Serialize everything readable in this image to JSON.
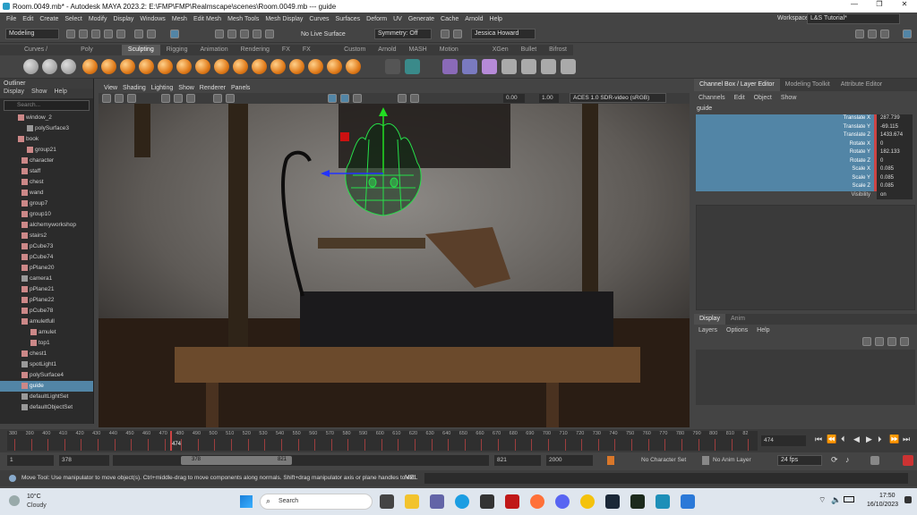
{
  "title": "Room.0049.mb* - Autodesk MAYA 2023.2: E:\\FMP\\FMP\\Realmscape\\scenes\\Room.0049.mb  ---  guide",
  "menu": [
    "File",
    "Edit",
    "Create",
    "Select",
    "Modify",
    "Display",
    "Windows",
    "Mesh",
    "Edit Mesh",
    "Mesh Tools",
    "Mesh Display",
    "Curves",
    "Surfaces",
    "Deform",
    "UV",
    "Generate",
    "Cache",
    "Arnold",
    "Help"
  ],
  "workspace_label": "Workspace:",
  "workspace": "L&S Tutorial*",
  "mode": "Modeling",
  "live_surface": "No Live Surface",
  "symmetry": "Symmetry: Off",
  "user": "Jessica Howard",
  "shelf_tabs": [
    "Curves / Surfaces",
    "Poly Modeling",
    "Sculpting",
    "Rigging",
    "Animation",
    "Rendering",
    "FX",
    "FX Caching",
    "Custom",
    "Arnold",
    "MASH",
    "Motion Graphics",
    "XGen",
    "Bullet",
    "Bifrost"
  ],
  "active_shelf": "Sculpting",
  "outliner": {
    "title": "Outliner",
    "menu": [
      "Display",
      "Show",
      "Help"
    ],
    "search_placeholder": "Search...",
    "items": [
      "window_2",
      "polySurface3",
      "book",
      "group21",
      "character",
      "staff",
      "chest",
      "wand",
      "group7",
      "group10",
      "alchemyworkshop",
      "stairs2",
      "pCube73",
      "pCube74",
      "pPlane20",
      "camera1",
      "pPlane21",
      "pPlane22",
      "pCube78",
      "amuletfull",
      "amulet",
      "top1",
      "chest1",
      "spotLight1",
      "polySurface4",
      "guide",
      "defaultLightSet",
      "defaultObjectSet"
    ],
    "selected": "guide"
  },
  "viewport": {
    "menu": [
      "View",
      "Shading",
      "Lighting",
      "Show",
      "Renderer",
      "Panels"
    ],
    "field_a": "0.00",
    "field_b": "1.00",
    "colorspace": "ACES 1.0 SDR-video (sRGB)"
  },
  "channel_box": {
    "tabs": [
      "Channel Box / Layer Editor",
      "Modeling Toolkit",
      "Attribute Editor"
    ],
    "menu": [
      "Channels",
      "Edit",
      "Object",
      "Show"
    ],
    "object": "guide",
    "attrs": [
      {
        "name": "Translate X",
        "value": "287.739"
      },
      {
        "name": "Translate Y",
        "value": "-69.115"
      },
      {
        "name": "Translate Z",
        "value": "1433.674"
      },
      {
        "name": "Rotate X",
        "value": "0"
      },
      {
        "name": "Rotate Y",
        "value": "182.133"
      },
      {
        "name": "Rotate Z",
        "value": "0"
      },
      {
        "name": "Scale X",
        "value": "0.085"
      },
      {
        "name": "Scale Y",
        "value": "0.085"
      },
      {
        "name": "Scale Z",
        "value": "0.085"
      },
      {
        "name": "Visibility",
        "value": "on"
      }
    ],
    "layer_tabs": [
      "Display",
      "Anim"
    ],
    "layer_menu": [
      "Layers",
      "Options",
      "Help"
    ]
  },
  "timeline": {
    "ticks": [
      "380",
      "390",
      "400",
      "410",
      "420",
      "430",
      "440",
      "450",
      "460",
      "470",
      "480",
      "490",
      "500",
      "510",
      "520",
      "530",
      "540",
      "550",
      "560",
      "570",
      "580",
      "590",
      "600",
      "610",
      "620",
      "630",
      "640",
      "650",
      "660",
      "670",
      "680",
      "690",
      "700",
      "710",
      "720",
      "730",
      "740",
      "750",
      "760",
      "770",
      "780",
      "790",
      "800",
      "810",
      "82"
    ],
    "current": "474",
    "current_field": "474"
  },
  "range": {
    "start": "1",
    "inner_start": "378",
    "slider_start": "378",
    "slider_end": "821",
    "inner_end": "821",
    "end": "2000",
    "character_set": "No Character Set",
    "anim_layer": "No Anim Layer",
    "fps": "24 fps"
  },
  "help_line": "Move Tool: Use manipulator to move object(s). Ctrl+middle-drag to move components along normals. Shift+drag manipulator axis or plane handles to ext",
  "mel_label": "MEL",
  "taskbar": {
    "temp": "10°C",
    "weather": "Cloudy",
    "search": "Search",
    "time": "17:50",
    "date": "16/10/2023"
  }
}
